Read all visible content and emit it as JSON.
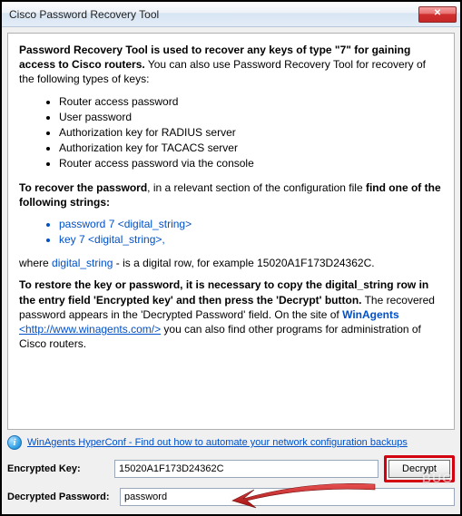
{
  "window": {
    "title": "Cisco Password Recovery Tool"
  },
  "intro": {
    "bold1": "Password Recovery Tool is used to recover any keys of type \"7\" for gaining access to Cisco routers.",
    "rest1": " You can also use Password Recovery Tool for recovery of the following types of keys:"
  },
  "keytypes": [
    "Router access password",
    "User password",
    "Authorization key for RADIUS server",
    "Authorization key for TACACS server",
    "Router access password via the console"
  ],
  "recover": {
    "b1": "To recover the password",
    "t1": ", in a relevant section of the configuration file ",
    "b2": "find one of the following strings:"
  },
  "strings": [
    "password 7 <digital_string>",
    "key 7 <digital_string>,"
  ],
  "where": {
    "t1": "where ",
    "link": "digital_string",
    "t2": " - is a digital row, for example 15020A1F173D24362C."
  },
  "restore": {
    "b1": "To restore the key or password, it is necessary to copy the digital_string row in the entry field 'Encrypted key' and then press the 'Decrypt' button.",
    "t1": " The recovered password appears in the 'Decrypted Password' field. On the site of ",
    "wlabel": "WinAgents",
    "wurl": "<http://www.winagents.com/>",
    "t2": " you can also find other programs for administration of Cisco routers."
  },
  "hyperconf": {
    "text": "WinAgents HyperConf - Find out how to automate your network configuration backups"
  },
  "form": {
    "enc_label": "Encrypted Key:",
    "enc_value": "15020A1F173D24362C",
    "decrypt_label": "Decrypt",
    "dec_label": "Decrypted Password:",
    "dec_value": "password"
  },
  "watermark": "BUG"
}
